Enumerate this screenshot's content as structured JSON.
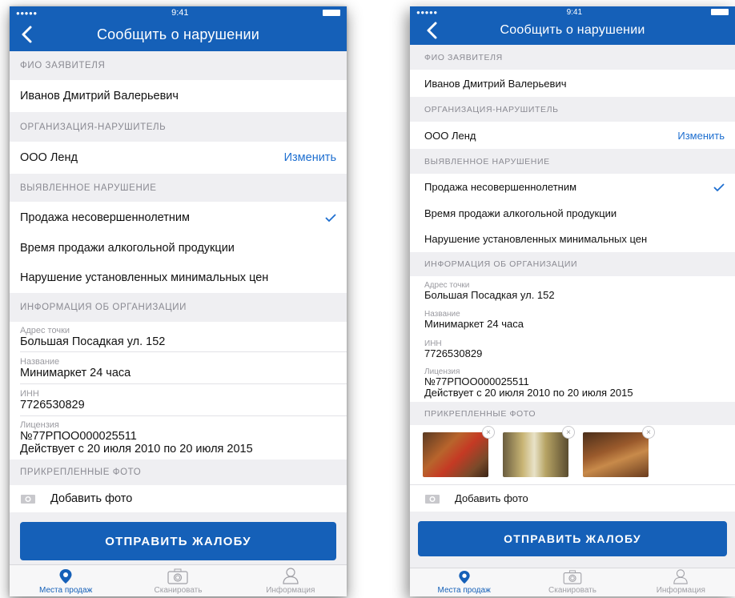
{
  "status": {
    "carrier": "●●●●●",
    "time": "9:41"
  },
  "nav": {
    "title": "Сообщить о нарушении"
  },
  "applicant": {
    "section": "ФИО ЗАЯВИТЕЛЯ",
    "name": "Иванов Дмитрий Валерьевич"
  },
  "offender": {
    "section": "ОРГАНИЗАЦИЯ-НАРУШИТЕЛЬ",
    "name": "ООО Ленд",
    "change_label": "Изменить"
  },
  "violation": {
    "section": "ВЫЯВЛЕННОЕ НАРУШЕНИЕ",
    "options": [
      {
        "label": "Продажа несовершеннолетним",
        "selected": true
      },
      {
        "label": "Время продажи алкогольной продукции",
        "selected": false
      },
      {
        "label": "Нарушение установленных минимальных цен",
        "selected": false
      }
    ]
  },
  "org_info": {
    "section": "ИНФОРМАЦИЯ ОБ ОРГАНИЗАЦИИ",
    "address_label": "Адрес точки",
    "address": "Большая Посадкая ул. 152",
    "name_label": "Название",
    "name": "Минимаркет 24 часа",
    "inn_label": "ИНН",
    "inn": "7726530829",
    "license_label": "Лицензия",
    "license_number": "№77РПОО000025511",
    "license_valid": "Действует с 20 июля 2010 по 20 июля 2015"
  },
  "photos": {
    "section": "ПРИКРЕПЛЕННЫЕ ФОТО",
    "add_label": "Добавить фото",
    "attached": [
      "photo-1",
      "photo-2",
      "photo-3"
    ],
    "remove_glyph": "×"
  },
  "submit": {
    "label": "ОТПРАВИТЬ ЖАЛОБУ"
  },
  "tabs": [
    {
      "label": "Места продаж",
      "icon": "location-pin-icon",
      "active": true
    },
    {
      "label": "Сканировать",
      "icon": "camera-icon",
      "active": false
    },
    {
      "label": "Информация",
      "icon": "person-icon",
      "active": false
    }
  ],
  "colors": {
    "accent": "#1560b8",
    "link": "#1e6fd0",
    "background": "#efeff2"
  }
}
